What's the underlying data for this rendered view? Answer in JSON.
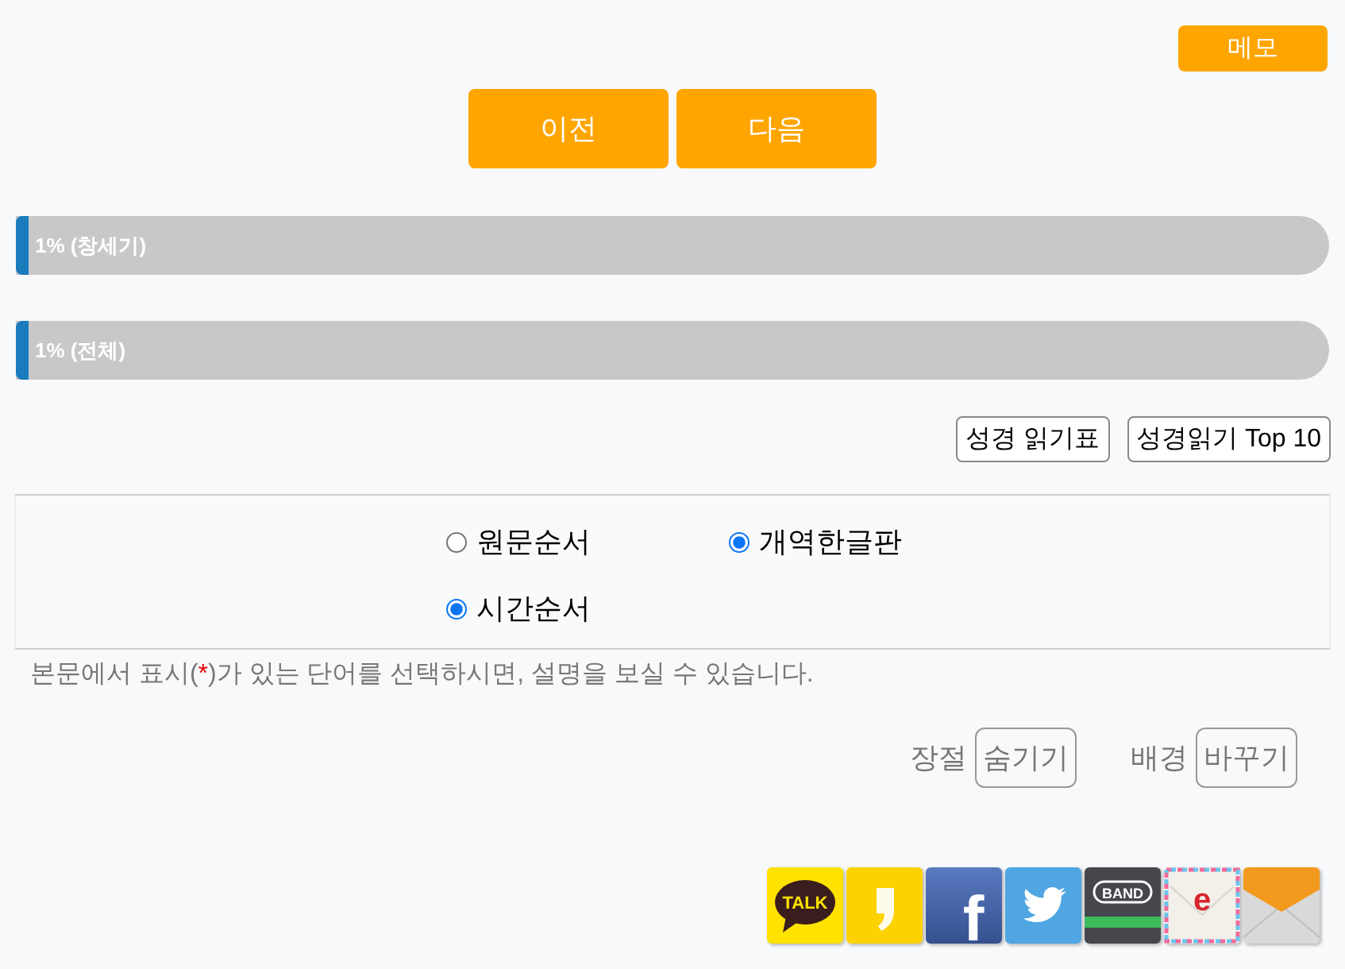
{
  "memo_button": "메모",
  "nav_buttons": [
    "이전",
    "다음"
  ],
  "progress": [
    {
      "label": "1% (창세기)",
      "level": 0.01
    },
    {
      "label": "1% (전체)",
      "level": 0.01
    }
  ],
  "link_buttons": [
    "성경 읽기표",
    "성경읽기 Top 10"
  ],
  "options": [
    {
      "label": "원문순서",
      "checked": false
    },
    {
      "label": "개역한글판",
      "checked": true
    },
    {
      "label": "시간순서",
      "checked": true
    }
  ],
  "note": {
    "before": "본문에서 표시(",
    "mark": "*",
    "after": ")가 있는 단어를 선택하시면, 설명을 보실 수 있습니다."
  },
  "toggles": [
    {
      "label": "장절",
      "button": "숨기기"
    },
    {
      "label": "배경",
      "button": "바꾸기"
    }
  ],
  "share_icons": [
    {
      "kind": "talk",
      "text": "TALK"
    },
    {
      "kind": "comma"
    },
    {
      "kind": "letter",
      "text": "f"
    },
    {
      "kind": "bird"
    },
    {
      "kind": "band",
      "text": "BAND"
    },
    {
      "kind": "airmail",
      "text": "e"
    },
    {
      "kind": "envelope"
    }
  ]
}
